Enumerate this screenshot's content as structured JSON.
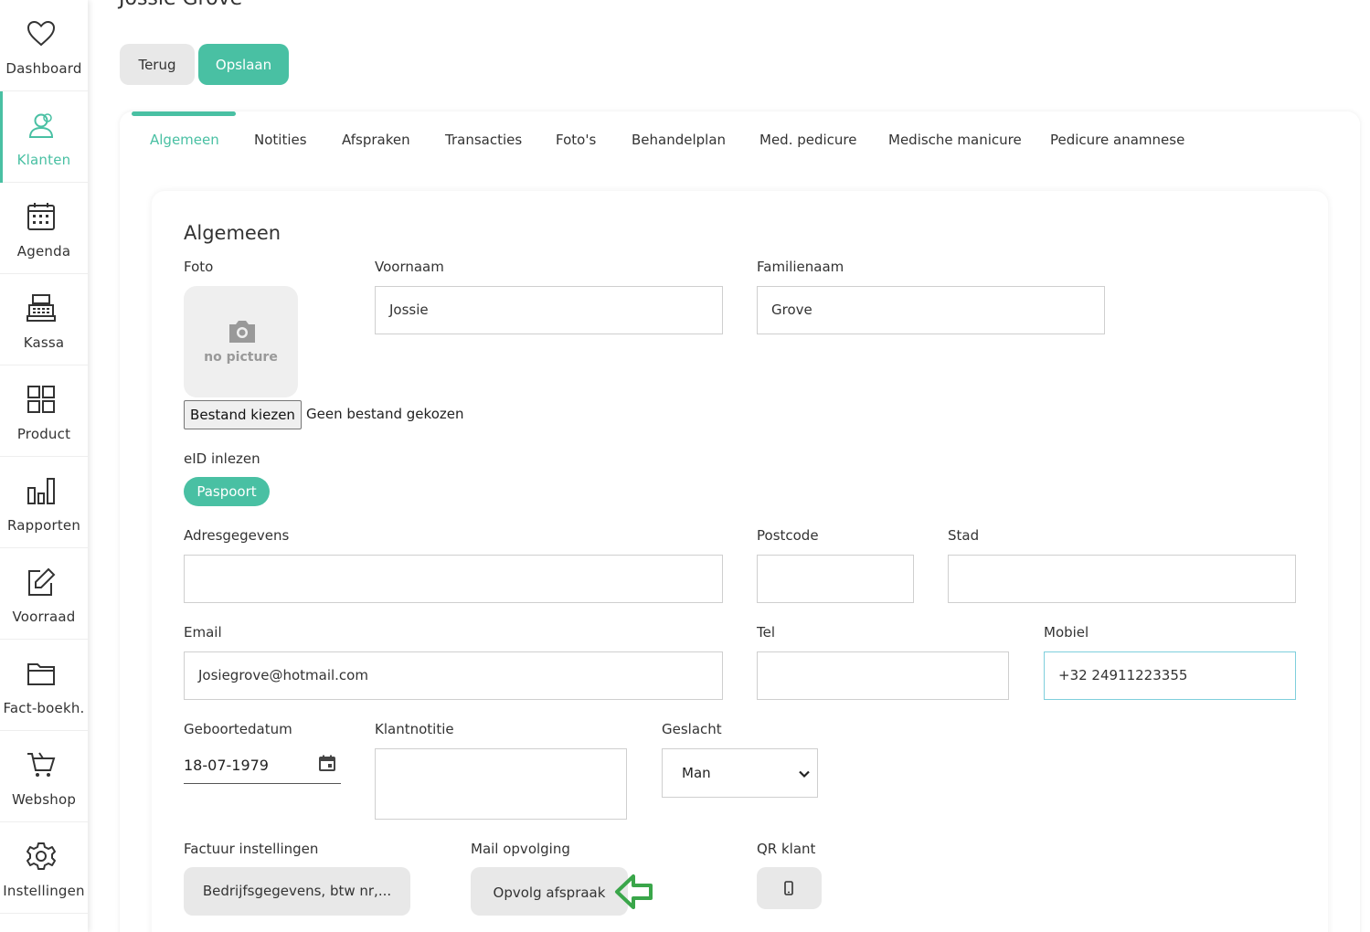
{
  "page": {
    "title": "Jossie Grove"
  },
  "sidebar": {
    "items": [
      {
        "label": "Dashboard",
        "icon": "heart-icon"
      },
      {
        "label": "Klanten",
        "icon": "users-icon",
        "active": true
      },
      {
        "label": "Agenda",
        "icon": "calendar-icon"
      },
      {
        "label": "Kassa",
        "icon": "cash-register-icon"
      },
      {
        "label": "Product",
        "icon": "grid-icon"
      },
      {
        "label": "Rapporten",
        "icon": "bar-chart-icon"
      },
      {
        "label": "Voorraad",
        "icon": "edit-icon"
      },
      {
        "label": "Fact-boekh.",
        "icon": "folder-icon"
      },
      {
        "label": "Webshop",
        "icon": "cart-icon"
      },
      {
        "label": "Instellingen",
        "icon": "gear-icon"
      }
    ]
  },
  "actions": {
    "back_label": "Terug",
    "save_label": "Opslaan"
  },
  "tabs": [
    {
      "label": "Algemeen",
      "active": true
    },
    {
      "label": "Notities"
    },
    {
      "label": "Afspraken"
    },
    {
      "label": "Transacties"
    },
    {
      "label": "Foto's"
    },
    {
      "label": "Behandelplan"
    },
    {
      "label": "Med. pedicure"
    },
    {
      "label": "Medische manicure"
    },
    {
      "label": "Pedicure anamnese"
    }
  ],
  "form": {
    "section_title": "Algemeen",
    "photo": {
      "label": "Foto",
      "placeholder_text": "no picture",
      "file_button": "Bestand kiezen",
      "file_status": "Geen bestand gekozen"
    },
    "voornaam": {
      "label": "Voornaam",
      "value": "Jossie"
    },
    "familienaam": {
      "label": "Familienaam",
      "value": "Grove"
    },
    "eid": {
      "label": "eID inlezen",
      "button": "Paspoort"
    },
    "adres": {
      "label": "Adresgegevens",
      "value": ""
    },
    "postcode": {
      "label": "Postcode",
      "value": ""
    },
    "stad": {
      "label": "Stad",
      "value": ""
    },
    "email": {
      "label": "Email",
      "value": "Josiegrove@hotmail.com"
    },
    "tel": {
      "label": "Tel",
      "value": ""
    },
    "mobiel": {
      "label": "Mobiel",
      "value": "+32 24911223355"
    },
    "geboortedatum": {
      "label": "Geboortedatum",
      "value": "18-07-1979"
    },
    "klantnotitie": {
      "label": "Klantnotitie",
      "value": ""
    },
    "geslacht": {
      "label": "Geslacht",
      "value": "Man"
    },
    "factuur": {
      "label": "Factuur instellingen",
      "button": "Bedrijfsgegevens, btw nr,..."
    },
    "mail": {
      "label": "Mail opvolging",
      "button": "Opvolg afspraak"
    },
    "qr": {
      "label": "QR klant"
    }
  },
  "colors": {
    "accent": "#49c0a3",
    "arrow": "#3aa64a"
  }
}
